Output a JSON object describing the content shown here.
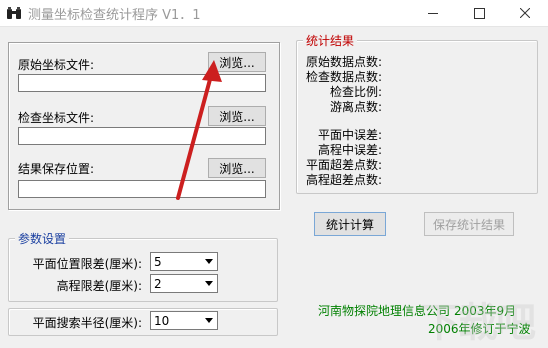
{
  "window": {
    "title": "测量坐标检查统计程序 V1．1",
    "controls": [
      "minimize",
      "maximize",
      "close"
    ]
  },
  "files": {
    "source_label": "原始坐标文件:",
    "check_label": "检查坐标文件:",
    "result_label": "结果保存位置:",
    "browse_label": "浏览..."
  },
  "stats": {
    "legend": "统计结果",
    "items": [
      "原始数据点数:",
      "检查数据点数:",
      "检查比例:",
      "游离点数:"
    ],
    "errors": [
      "平面中误差:",
      "高程中误差:",
      "平面超差点数:",
      "高程超差点数:"
    ]
  },
  "params": {
    "legend": "参数设置",
    "plane_label": "平面位置限差(厘米):",
    "plane_value": "5",
    "height_label": "高程限差(厘米):",
    "height_value": "2",
    "radius_label": "平面搜索半径(厘米):",
    "radius_value": "10"
  },
  "actions": {
    "compute": "统计计算",
    "save": "保存统计结果"
  },
  "footer": {
    "company": "河南物探院地理信息公司",
    "date": "2003年9月",
    "revision": "2006年修订于宁波",
    "color": "#008000"
  },
  "watermark": "下载吧",
  "icons": {
    "app": "binoculars-icon",
    "annotation": "red-arrow"
  }
}
